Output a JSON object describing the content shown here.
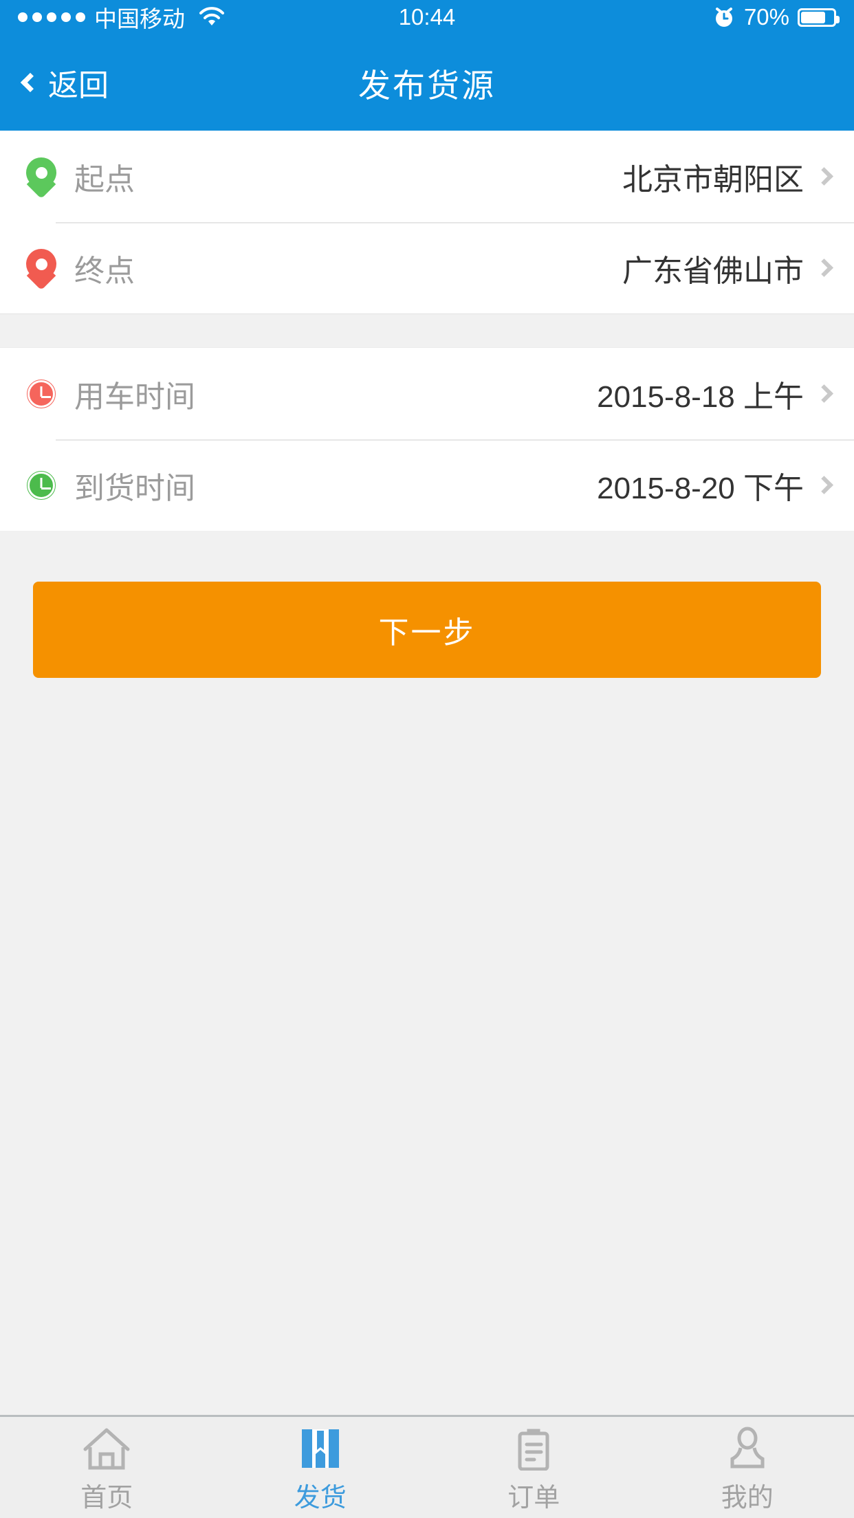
{
  "status_bar": {
    "signal_dots": 5,
    "carrier": "中国移动",
    "wifi_icon": "wifi-icon",
    "time": "10:44",
    "alarm_icon": "alarm-clock-icon",
    "battery_percent": "70%",
    "battery_level": 70
  },
  "nav": {
    "back_label": "返回",
    "back_icon": "chevron-left-icon",
    "title": "发布货源",
    "bg_color": "#0d8ddb"
  },
  "form": {
    "group_one": [
      {
        "icon": "map-pin-icon",
        "icon_color": "#5cc85c",
        "label": "起点",
        "value": "北京市朝阳区",
        "chevron": "chevron-right-icon"
      },
      {
        "icon": "map-pin-icon",
        "icon_color": "#f15b50",
        "label": "终点",
        "value": "广东省佛山市",
        "chevron": "chevron-right-icon"
      }
    ],
    "group_two": [
      {
        "icon": "clock-icon",
        "icon_color": "#f5655c",
        "label": "用车时间",
        "value": "2015-8-18 上午",
        "chevron": "chevron-right-icon"
      },
      {
        "icon": "clock-icon",
        "icon_color": "#4cbb4c",
        "label": "到货时间",
        "value": "2015-8-20 下午",
        "chevron": "chevron-right-icon"
      }
    ]
  },
  "action": {
    "next_label": "下一步",
    "color": "#f59100"
  },
  "tabbar": {
    "active_color": "#3d9bdd",
    "inactive_color": "#a2a2a2",
    "items": [
      {
        "icon": "home-icon",
        "label": "首页",
        "active": false
      },
      {
        "icon": "package-icon",
        "label": "发货",
        "active": true
      },
      {
        "icon": "clipboard-icon",
        "label": "订单",
        "active": false
      },
      {
        "icon": "person-icon",
        "label": "我的",
        "active": false
      }
    ]
  }
}
